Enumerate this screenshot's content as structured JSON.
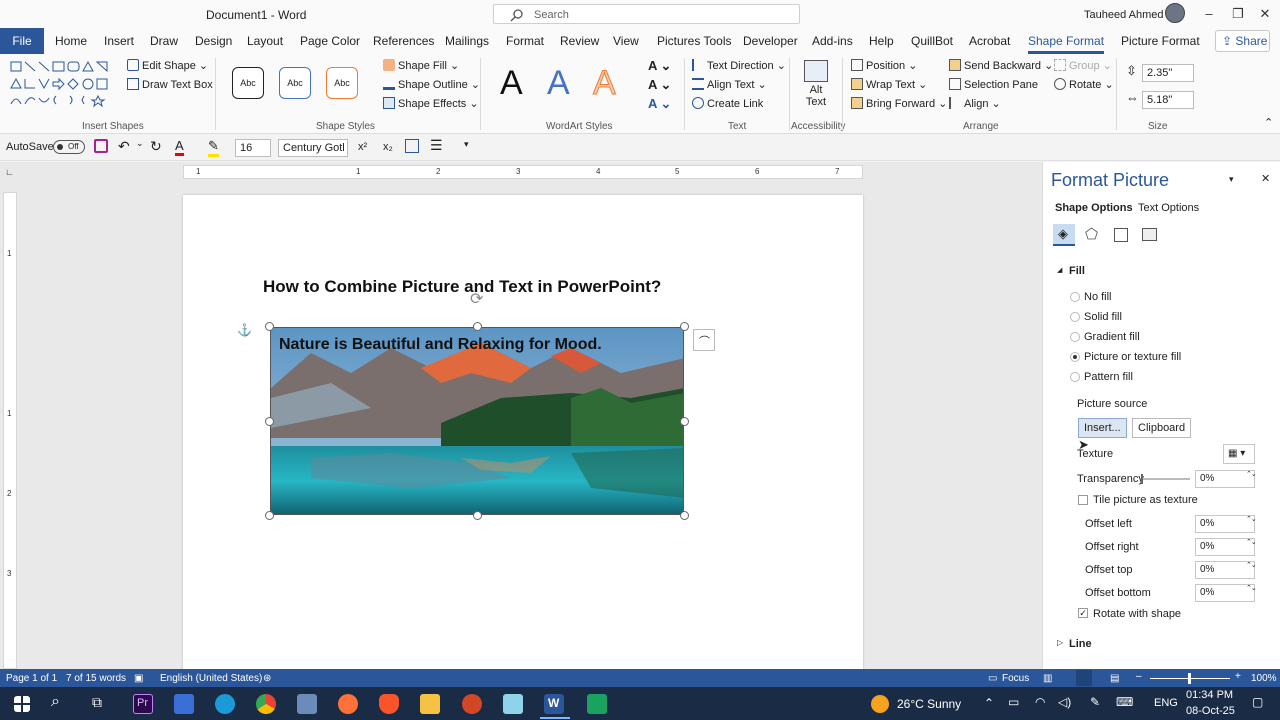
{
  "titlebar": {
    "doc_title": "Document1  -  Word",
    "search_placeholder": "Search",
    "user_name": "Tauheed Ahmed"
  },
  "tabs": [
    "File",
    "Home",
    "Insert",
    "Draw",
    "Design",
    "Layout",
    "Page Color",
    "References",
    "Mailings",
    "Format",
    "Review",
    "View",
    "Pictures Tools",
    "Developer",
    "Add-ins",
    "Help",
    "QuillBot",
    "Acrobat",
    "Shape Format",
    "Picture Format"
  ],
  "active_tab": "Shape Format",
  "share_label": "Share",
  "ribbon": {
    "insert_shapes": {
      "edit_shape": "Edit Shape",
      "draw_text_box": "Draw Text Box",
      "label": "Insert Shapes"
    },
    "shape_styles": {
      "style_sample": "Abc",
      "shape_fill": "Shape Fill",
      "shape_outline": "Shape Outline",
      "shape_effects": "Shape Effects",
      "label": "Shape Styles"
    },
    "wordart": {
      "glyph": "A",
      "label": "WordArt Styles"
    },
    "text": {
      "text_direction": "Text Direction",
      "align_text": "Align Text",
      "create_link": "Create Link",
      "label": "Text"
    },
    "accessibility": {
      "alt_text_line1": "Alt",
      "alt_text_line2": "Text",
      "label": "Accessibility"
    },
    "arrange": {
      "position": "Position",
      "wrap_text": "Wrap Text",
      "bring_forward": "Bring Forward",
      "send_backward": "Send Backward",
      "selection_pane": "Selection Pane",
      "align": "Align",
      "group": "Group",
      "rotate": "Rotate",
      "label": "Arrange"
    },
    "size": {
      "height": "2.35\"",
      "width": "5.18\"",
      "label": "Size"
    }
  },
  "qat": {
    "autosave": "AutoSave",
    "toggle": "Off",
    "font_size": "16",
    "font_name": "Century Gotl",
    "superscript": "x²",
    "subscript": "x₂"
  },
  "ruler": {
    "h_numbers": [
      "1",
      "1",
      "2",
      "3",
      "4",
      "5",
      "6",
      "7"
    ],
    "v_numbers": [
      "1",
      "1",
      "2",
      "3"
    ]
  },
  "document": {
    "heading": "How to Combine Picture and Text in PowerPoint?",
    "picture_text": "Nature is Beautiful and Relaxing for Mood."
  },
  "pane": {
    "title": "Format Picture",
    "tab_shape_options": "Shape Options",
    "tab_text_options": "Text Options",
    "fill_section": "Fill",
    "fill_options": [
      "No fill",
      "Solid fill",
      "Gradient fill",
      "Picture or texture fill",
      "Pattern fill"
    ],
    "selected_fill": "Picture or texture fill",
    "picture_source": "Picture source",
    "insert_btn": "Insert...",
    "clipboard_btn": "Clipboard",
    "texture": "Texture",
    "transparency": "Transparency",
    "transparency_value": "0%",
    "tile_label": "Tile picture as texture",
    "offset_left": "Offset left",
    "offset_right": "Offset right",
    "offset_top": "Offset top",
    "offset_bottom": "Offset bottom",
    "offset_value": "0%",
    "rotate_label": "Rotate with shape",
    "line_section": "Line"
  },
  "status": {
    "page": "Page 1 of 1",
    "words": "7 of 15 words",
    "language": "English (United States)",
    "focus": "Focus",
    "zoom": "100%"
  },
  "taskbar": {
    "weather": "26°C  Sunny",
    "lang": "ENG",
    "time": "01:34 PM",
    "date": "08-Oct-25"
  },
  "colors": {
    "accent": "#2b579a",
    "taskbar": "#1a2b45"
  }
}
